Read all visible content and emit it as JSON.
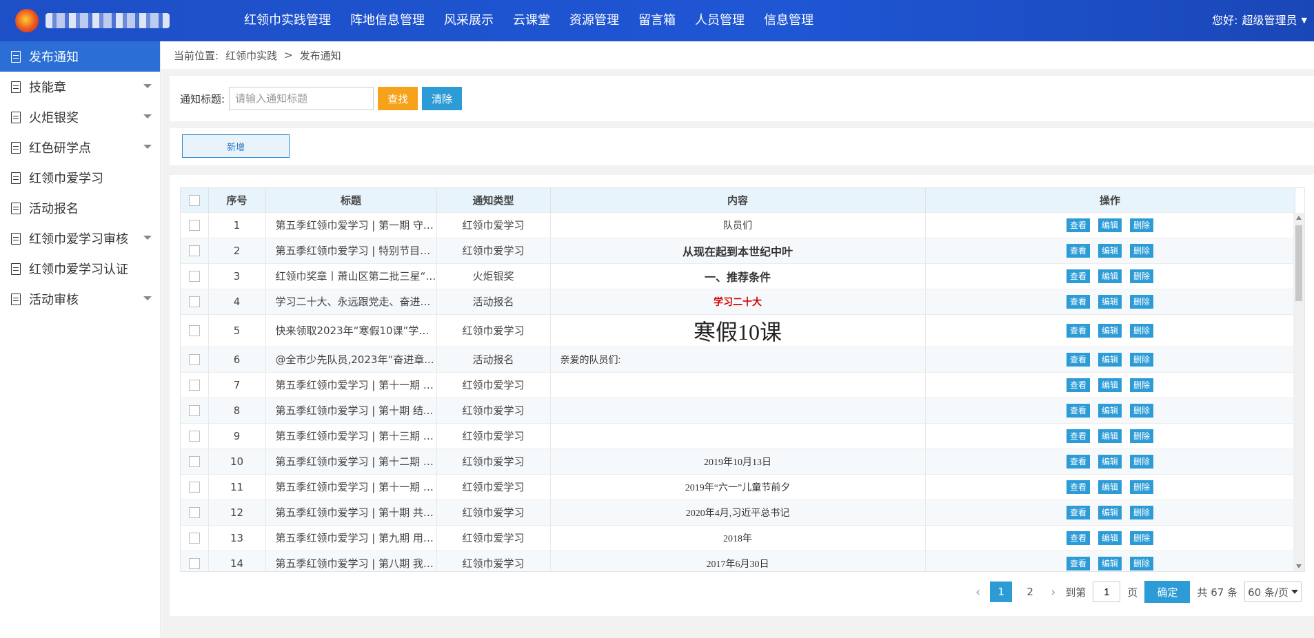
{
  "header": {
    "nav": [
      "红领巾实践管理",
      "阵地信息管理",
      "风采展示",
      "云课堂",
      "资源管理",
      "留言箱",
      "人员管理",
      "信息管理"
    ],
    "user_greeting": "您好:",
    "user_name": "超级管理员"
  },
  "sidebar": {
    "items": [
      {
        "label": "发布通知",
        "active": true,
        "expandable": false
      },
      {
        "label": "技能章",
        "active": false,
        "expandable": true
      },
      {
        "label": "火炬银奖",
        "active": false,
        "expandable": true
      },
      {
        "label": "红色研学点",
        "active": false,
        "expandable": true
      },
      {
        "label": "红领巾爱学习",
        "active": false,
        "expandable": false
      },
      {
        "label": "活动报名",
        "active": false,
        "expandable": false
      },
      {
        "label": "红领巾爱学习审核",
        "active": false,
        "expandable": true
      },
      {
        "label": "红领巾爱学习认证",
        "active": false,
        "expandable": false
      },
      {
        "label": "活动审核",
        "active": false,
        "expandable": true
      }
    ]
  },
  "breadcrumb": {
    "prefix": "当前位置:",
    "level1": "红领巾实践",
    "sep": ">",
    "level2": "发布通知"
  },
  "search": {
    "label": "通知标题:",
    "placeholder": "请输入通知标题",
    "find_label": "查找",
    "clear_label": "清除"
  },
  "add_label": "新增",
  "table": {
    "columns": [
      "序号",
      "标题",
      "通知类型",
      "内容",
      "操作"
    ],
    "op_labels": {
      "view": "查看",
      "edit": "编辑",
      "delete": "删除"
    },
    "rows": [
      {
        "no": "1",
        "title": "第五季红领巾爱学习 | 第一期 守护...",
        "type": "红领巾爱学习",
        "content": "队员们"
      },
      {
        "no": "2",
        "title": "第五季红领巾爱学习 | 特别节目的远征",
        "type": "红领巾爱学习",
        "content": "从现在起到本世纪中叶"
      },
      {
        "no": "3",
        "title": "红领巾奖章丨萧山区第二批三星“火...",
        "type": "火炬银奖",
        "content": "一、推荐条件"
      },
      {
        "no": "4",
        "title": "学习二十大、永远跟党走、奋进新征...",
        "type": "活动报名",
        "content": "学习二十大"
      },
      {
        "no": "5",
        "title": "快来领取2023年“寒假10课”学习...",
        "type": "红领巾爱学习",
        "content": "寒假10课"
      },
      {
        "no": "6",
        "title": "@全市少先队员,2023年“奋进章...",
        "type": "活动报名",
        "content": "亲爱的队员们:"
      },
      {
        "no": "7",
        "title": "第五季红领巾爱学习 | 第十一期 入...",
        "type": "红领巾爱学习",
        "content": ""
      },
      {
        "no": "8",
        "title": "第五季红领巾爱学习 | 第十期 结...",
        "type": "红领巾爱学习",
        "content": ""
      },
      {
        "no": "9",
        "title": "第五季红领巾爱学习 | 第十三期 为...",
        "type": "红领巾爱学习",
        "content": ""
      },
      {
        "no": "10",
        "title": "第五季红领巾爱学习 | 第十二期 从...",
        "type": "红领巾爱学习",
        "content": "2019年10月13日"
      },
      {
        "no": "11",
        "title": "第五季红领巾爱学习 | 第十一期 澳...",
        "type": "红领巾爱学习",
        "content": "2019年“六一”儿童节前夕"
      },
      {
        "no": "12",
        "title": "第五季红领巾爱学习 | 第十期 共同...",
        "type": "红领巾爱学习",
        "content": "2020年4月,习近平总书记"
      },
      {
        "no": "13",
        "title": "第五季红领巾爱学习 | 第九期 用实...",
        "type": "红领巾爱学习",
        "content": "2018年"
      },
      {
        "no": "14",
        "title": "第五季红领巾爱学习 | 第八期 我们...",
        "type": "红领巾爱学习",
        "content": "2017年6月30日"
      }
    ]
  },
  "pager": {
    "pages": [
      "1",
      "2"
    ],
    "current": "1",
    "goto_label": "到第",
    "goto_value": "1",
    "page_unit": "页",
    "confirm_label": "确定",
    "total_text": "共 67 条",
    "page_size": "60 条/页"
  },
  "colors": {
    "header_bg": "#1f56d4",
    "sidebar_active": "#2b6fd6",
    "btn_find": "#f7a21b",
    "btn_blue": "#2c9bd6"
  }
}
